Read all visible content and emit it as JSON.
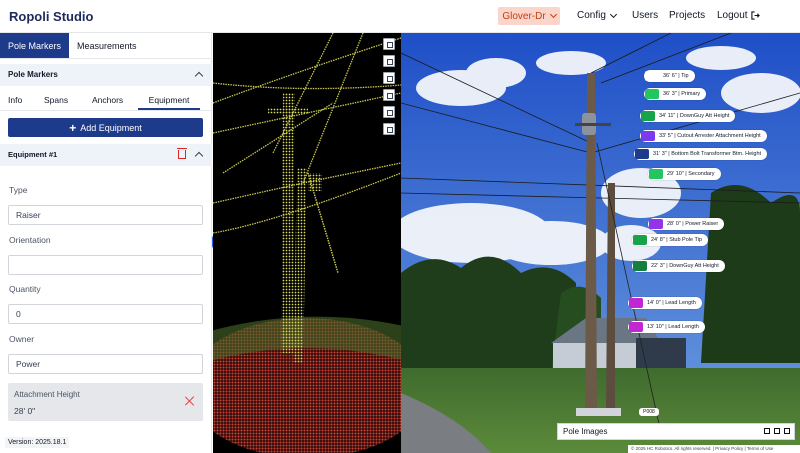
{
  "header": {
    "brand": "Ropoli Studio",
    "project": "Glover-Dr",
    "nav": {
      "config": "Config",
      "users": "Users",
      "projects": "Projects",
      "logout": "Logout"
    }
  },
  "left_panel": {
    "tabs": [
      "Pole Markers",
      "Measurements"
    ],
    "section_title": "Pole Markers",
    "subtabs": [
      "Info",
      "Spans",
      "Anchors",
      "Equipment"
    ],
    "add_button": "Add Equipment",
    "equipment_title": "Equipment #1",
    "fields": {
      "type_label": "Type",
      "type_value": "Raiser",
      "orientation_label": "Orientation",
      "orientation_value": "",
      "quantity_label": "Quantity",
      "quantity_value": "0",
      "owner_label": "Owner",
      "owner_value": "Power",
      "attachment_label": "Attachment Height",
      "attachment_value": "28' 0\""
    },
    "version": "Version: 2025.18.1"
  },
  "markers": [
    {
      "text": "36' 6\" | Tip",
      "color": "#ffffff"
    },
    {
      "text": "36' 3\" | Primary",
      "color": "#22c55e"
    },
    {
      "text": "34' 11\" | DownGuy Att Height",
      "color": "#16a34a"
    },
    {
      "text": "33' 5\" | Cutout Arrester Attachment Height",
      "color": "#7c3aed"
    },
    {
      "text": "31' 3\" | Bottom Bolt Transformer Btm. Height",
      "color": "#1e3a8a"
    },
    {
      "text": "29' 10\" | Secondary",
      "color": "#22c55e"
    },
    {
      "text": "28' 0\" | Power Raiser",
      "color": "#9333ea"
    },
    {
      "text": "24' 8\" | Stub Pole Tip",
      "color": "#16a34a"
    },
    {
      "text": "22' 3\" | DownGuy Att Height",
      "color": "#15803d"
    },
    {
      "text": "14' 0\" | Lead Length",
      "color": "#c026d3"
    },
    {
      "text": "13' 10\" | Lead Length",
      "color": "#c026d3"
    }
  ],
  "pole_tag": "P008",
  "pole_images_label": "Pole Images",
  "footer": "© 2025 HC Robotics. All rights reserved. | Privacy Policy | Terms of Use"
}
